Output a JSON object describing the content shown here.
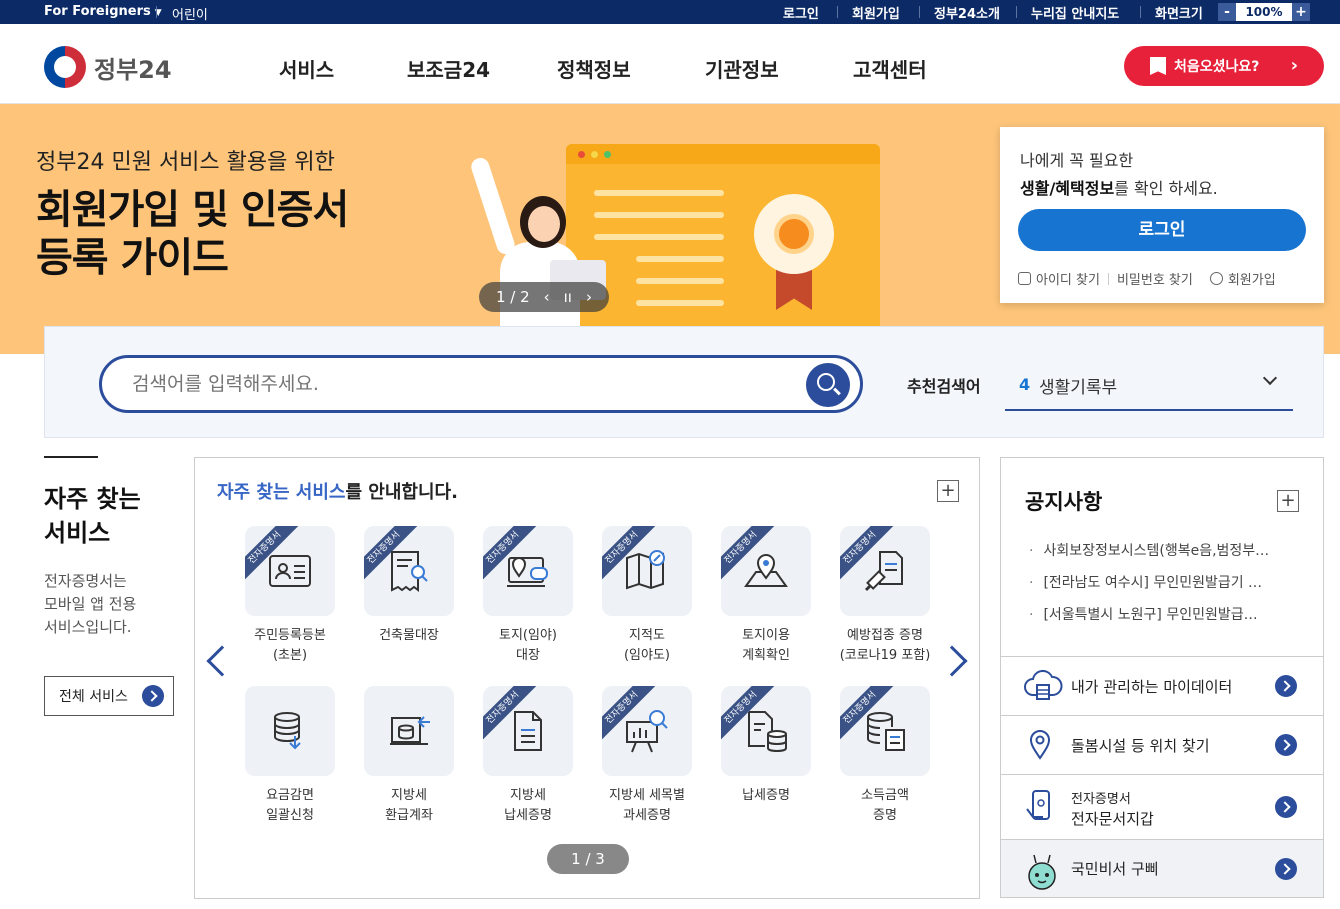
{
  "topbar": {
    "lang": "For Foreigners",
    "kid": "어린이",
    "links": [
      "로그인",
      "회원가입",
      "정부24소개",
      "누리집 안내지도",
      "화면크기"
    ],
    "zoom": {
      "minus": "-",
      "value": "100%",
      "plus": "+"
    }
  },
  "header": {
    "logo": "정부24",
    "nav": [
      "서비스",
      "보조금24",
      "정책정보",
      "기관정보",
      "고객센터"
    ],
    "first_visit": "처음오셨나요?"
  },
  "banner": {
    "subtitle": "정부24 민원 서비스 활용을 위한",
    "title_line1": "회원가입 및 인증서",
    "title_line2": "등록 가이드",
    "pager": "1 / 2"
  },
  "login": {
    "msg1": "나에게 꼭 필요한",
    "msg2_bold": "생활/혜택정보",
    "msg2_rest": "를 확인 하세요.",
    "button": "로그인",
    "links": [
      "아이디 찾기",
      "비밀번호 찾기",
      "회원가입"
    ]
  },
  "search": {
    "placeholder": "검색어를 입력해주세요.",
    "rec_label": "추천검색어",
    "rec_num": "4",
    "rec_value": "생활기록부"
  },
  "freq": {
    "title_line1": "자주 찾는",
    "title_line2": "서비스",
    "desc_line1": "전자증명서는",
    "desc_line2": "모바일 앱 전용",
    "desc_line3": "서비스입니다.",
    "all_button": "전체 서비스"
  },
  "services": {
    "heading_highlight": "자주 찾는 서비스",
    "heading_rest": "를 안내합니다.",
    "plus": "+",
    "ribbon": "전자증명서",
    "pager": "1 / 3",
    "items": [
      {
        "label": "주민등록등본\n(초본)",
        "ribbon": true
      },
      {
        "label": "건축물대장",
        "ribbon": true
      },
      {
        "label": "토지(임야)\n대장",
        "ribbon": true
      },
      {
        "label": "지적도\n(임야도)",
        "ribbon": true
      },
      {
        "label": "토지이용\n계획확인",
        "ribbon": true
      },
      {
        "label": "예방접종 증명\n(코로나19 포함)",
        "ribbon": true
      },
      {
        "label": "요금감면\n일괄신청",
        "ribbon": false
      },
      {
        "label": "지방세\n환급계좌",
        "ribbon": false
      },
      {
        "label": "지방세\n납세증명",
        "ribbon": true
      },
      {
        "label": "지방세 세목별\n과세증명",
        "ribbon": true
      },
      {
        "label": "납세증명",
        "ribbon": true
      },
      {
        "label": "소득금액\n증명",
        "ribbon": true
      }
    ]
  },
  "notice": {
    "title": "공지사항",
    "plus": "+",
    "items": [
      "사회보장정보시스템(행복e음,범정부…",
      "[전라남도 여수시] 무인민원발급기 …",
      "[서울특별시 노원구] 무인민원발급…"
    ]
  },
  "side_links": [
    {
      "label": "내가 관리하는 마이데이터"
    },
    {
      "label": "돌봄시설 등 위치 찾기"
    },
    {
      "label_line1": "전자증명서",
      "label_line2": "전자문서지갑"
    },
    {
      "label": "국민비서 구삐"
    }
  ]
}
